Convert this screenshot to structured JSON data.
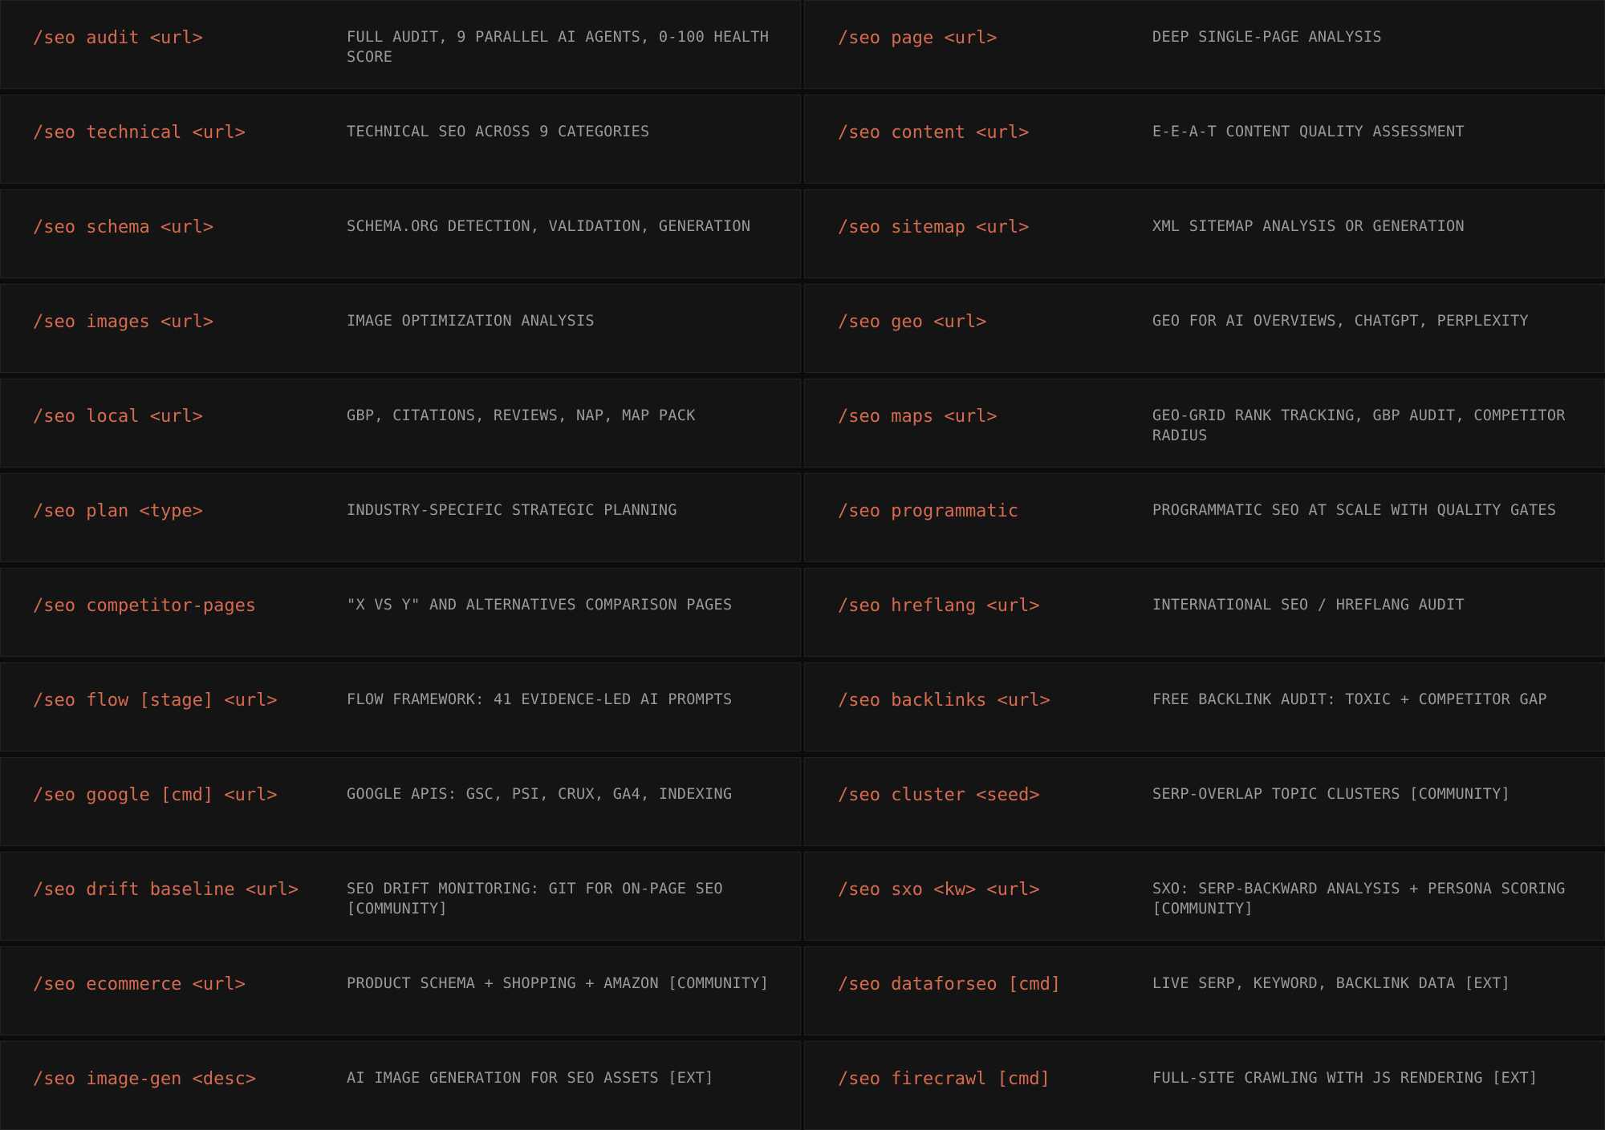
{
  "commands": [
    {
      "cmd": "/seo audit <url>",
      "desc": "FULL AUDIT, 9 PARALLEL AI AGENTS, 0-100 HEALTH SCORE"
    },
    {
      "cmd": "/seo page <url>",
      "desc": "DEEP SINGLE-PAGE ANALYSIS"
    },
    {
      "cmd": "/seo technical <url>",
      "desc": "TECHNICAL SEO ACROSS 9 CATEGORIES"
    },
    {
      "cmd": "/seo content <url>",
      "desc": "E-E-A-T CONTENT QUALITY ASSESSMENT"
    },
    {
      "cmd": "/seo schema <url>",
      "desc": "SCHEMA.ORG DETECTION, VALIDATION, GENERATION"
    },
    {
      "cmd": "/seo sitemap <url>",
      "desc": "XML SITEMAP ANALYSIS OR GENERATION"
    },
    {
      "cmd": "/seo images <url>",
      "desc": "IMAGE OPTIMIZATION ANALYSIS"
    },
    {
      "cmd": "/seo geo <url>",
      "desc": "GEO FOR AI OVERVIEWS, CHATGPT, PERPLEXITY"
    },
    {
      "cmd": "/seo local <url>",
      "desc": "GBP, CITATIONS, REVIEWS, NAP, MAP PACK"
    },
    {
      "cmd": "/seo maps <url>",
      "desc": "GEO-GRID RANK TRACKING, GBP AUDIT, COMPETITOR RADIUS"
    },
    {
      "cmd": "/seo plan <type>",
      "desc": "INDUSTRY-SPECIFIC STRATEGIC PLANNING"
    },
    {
      "cmd": "/seo programmatic",
      "desc": "PROGRAMMATIC SEO AT SCALE WITH QUALITY GATES"
    },
    {
      "cmd": "/seo competitor-pages",
      "desc": "\"X VS Y\" AND ALTERNATIVES COMPARISON PAGES"
    },
    {
      "cmd": "/seo hreflang <url>",
      "desc": "INTERNATIONAL SEO / HREFLANG AUDIT"
    },
    {
      "cmd": "/seo flow [stage] <url>",
      "desc": "FLOW FRAMEWORK: 41 EVIDENCE-LED AI PROMPTS"
    },
    {
      "cmd": "/seo backlinks <url>",
      "desc": "FREE BACKLINK AUDIT: TOXIC + COMPETITOR GAP"
    },
    {
      "cmd": "/seo google [cmd] <url>",
      "desc": "GOOGLE APIS: GSC, PSI, CRUX, GA4, INDEXING"
    },
    {
      "cmd": "/seo cluster <seed>",
      "desc": "SERP-OVERLAP TOPIC CLUSTERS [COMMUNITY]"
    },
    {
      "cmd": "/seo drift baseline <url>",
      "desc": "SEO DRIFT MONITORING: GIT FOR ON-PAGE SEO [COMMUNITY]"
    },
    {
      "cmd": "/seo sxo <kw> <url>",
      "desc": "SXO: SERP-BACKWARD ANALYSIS + PERSONA SCORING [COMMUNITY]"
    },
    {
      "cmd": "/seo ecommerce <url>",
      "desc": "PRODUCT SCHEMA + SHOPPING + AMAZON [COMMUNITY]"
    },
    {
      "cmd": "/seo dataforseo [cmd]",
      "desc": "LIVE SERP, KEYWORD, BACKLINK DATA [EXT]"
    },
    {
      "cmd": "/seo image-gen <desc>",
      "desc": "AI IMAGE GENERATION FOR SEO ASSETS [EXT]"
    },
    {
      "cmd": "/seo firecrawl [cmd]",
      "desc": "FULL-SITE CRAWLING WITH JS RENDERING [EXT]"
    }
  ]
}
